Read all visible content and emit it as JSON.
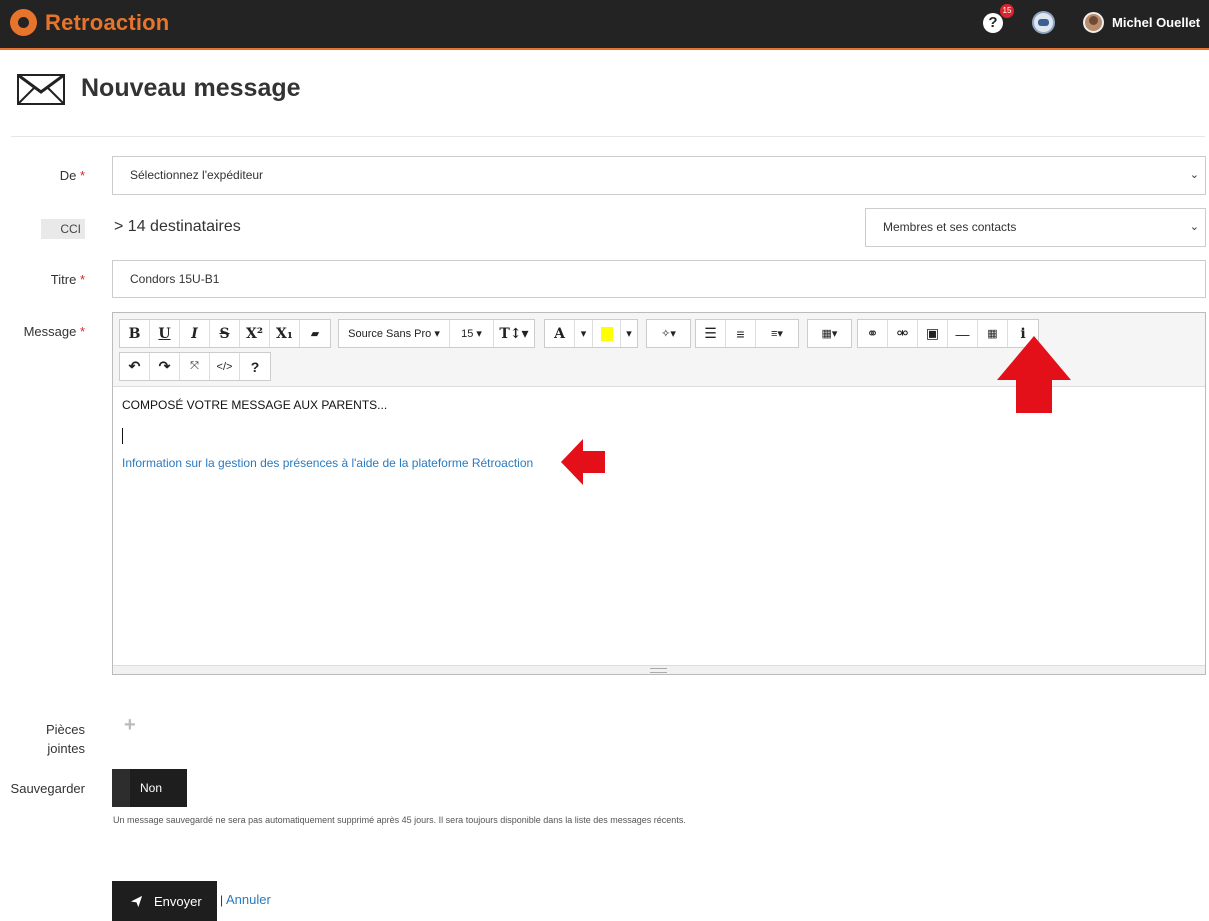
{
  "header": {
    "app_name": "Retroaction",
    "help_badge": "15",
    "user_name": "Michel Ouellet",
    "accent_color": "#e8742b"
  },
  "page": {
    "title": "Nouveau message",
    "icon": "envelope-icon"
  },
  "form": {
    "from": {
      "label": "De",
      "required_mark": "*",
      "value": "Sélectionnez l'expéditeur"
    },
    "bcc": {
      "label": "CCI",
      "summary": "14 destinataires",
      "chevron": ">",
      "filter_value": "Membres et ses contacts"
    },
    "subject": {
      "label": "Titre",
      "required_mark": "*",
      "value": "Condors 15U-B1"
    },
    "message": {
      "label": "Message",
      "required_mark": "*",
      "toolbar": {
        "bold": "B",
        "underline": "U",
        "italic": "I",
        "strike": "S",
        "superscript": "X²",
        "subscript": "X₁",
        "eraser": "▰",
        "font_family": "Source Sans Pro ▾",
        "font_size": "15 ▾",
        "line_height": "T↕▾",
        "font_color": "A",
        "dropdown": "▾",
        "magic": "✧▾",
        "bullets": "☰",
        "numbers": "≡",
        "align": "≡▾",
        "table": "▦▾",
        "link": "⚭",
        "unlink": "⚮",
        "image": "▣",
        "hr": "—",
        "calendar": "▦",
        "info": "i",
        "undo": "↶",
        "redo": "↷",
        "fullscreen": "⤧",
        "code": "</>",
        "help": "?"
      },
      "body_line1": "COMPOSÉ VOTRE MESSAGE AUX PARENTS...",
      "body_link": "Information sur la gestion des présences à l'aide de la plateforme Rétroaction"
    },
    "attachments": {
      "label_line1": "Pièces",
      "label_line2": "jointes",
      "add": "+"
    },
    "save": {
      "label": "Sauvegarder",
      "toggle_value": "Non",
      "hint": "Un message sauvegardé ne sera pas automatiquement supprimé après 45 jours. Il sera toujours disponible dans la liste des messages récents."
    },
    "actions": {
      "send": "Envoyer",
      "separator": "|",
      "cancel": "Annuler"
    }
  }
}
